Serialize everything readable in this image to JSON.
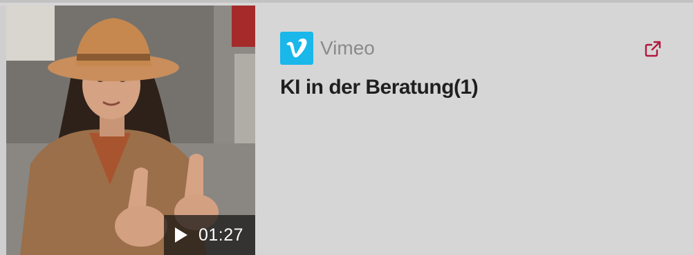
{
  "embed": {
    "provider": "Vimeo",
    "title": "KI in der Beratung(1)",
    "duration": "01:27",
    "icons": {
      "provider_logo": "vimeo-logo-icon",
      "external_link": "external-link-icon",
      "play": "play-icon"
    },
    "colors": {
      "vimeo_brand": "#1ab7ea",
      "external_link": "#b2163e",
      "background": "#d6d6d6"
    }
  }
}
